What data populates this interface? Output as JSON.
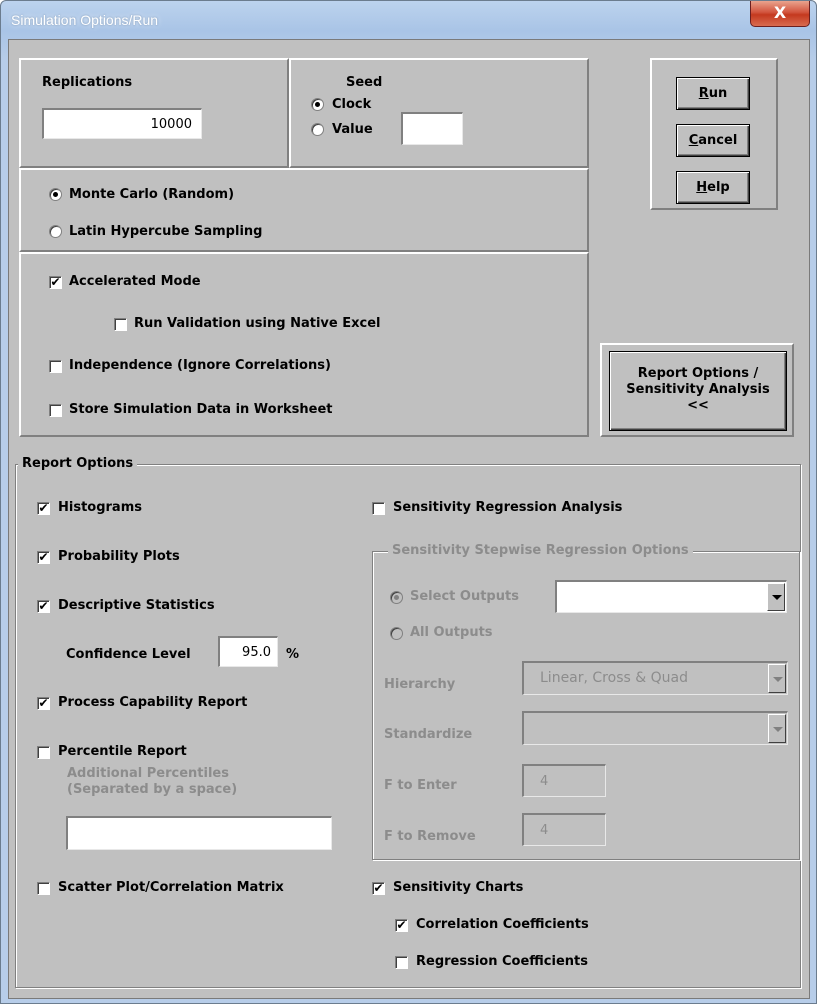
{
  "window": {
    "title": "Simulation Options/Run",
    "close_label": "X"
  },
  "replications": {
    "label": "Replications",
    "value": "10000"
  },
  "seed": {
    "label": "Seed",
    "clock_label": "Clock",
    "value_label": "Value",
    "value": ""
  },
  "sampling": {
    "monte_carlo_label": "Monte Carlo (Random)",
    "lhs_label": "Latin Hypercube Sampling"
  },
  "options": {
    "accelerated_label": "Accelerated Mode",
    "run_validation_label": "Run Validation using Native Excel",
    "independence_label": "Independence (Ignore Correlations)",
    "store_data_label": "Store Simulation Data in Worksheet"
  },
  "buttons": {
    "run_prefix": "R",
    "run_rest": "un",
    "cancel_prefix": "C",
    "cancel_rest": "ancel",
    "help_prefix": "H",
    "help_rest": "elp",
    "report_line1": "Report Options /",
    "report_line2": "Sensitivity Analysis",
    "report_line3": "<<"
  },
  "report": {
    "legend": "Report Options",
    "histograms_label": "Histograms",
    "probability_label": "Probability Plots",
    "descriptive_label": "Descriptive Statistics",
    "confidence_label": "Confidence Level",
    "confidence_value": "95.0",
    "percent_sign": "%",
    "process_label": "Process Capability Report",
    "percentile_label": "Percentile Report",
    "additional_line1": "Additional Percentiles",
    "additional_line2": "(Separated by a space)",
    "additional_value": "",
    "scatter_label": "Scatter Plot/Correlation Matrix"
  },
  "sensitivity": {
    "regression_label": "Sensitivity Regression Analysis",
    "stepwise_legend": "Sensitivity Stepwise Regression Options",
    "select_outputs_label": "Select Outputs",
    "all_outputs_label": "All Outputs",
    "hierarchy_label": "Hierarchy",
    "hierarchy_value": "Linear, Cross & Quad",
    "standardize_label": "Standardize",
    "standardize_value": "",
    "f_enter_label": "F to Enter",
    "f_enter_value": "4",
    "f_remove_label": "F to Remove",
    "f_remove_value": "4",
    "charts_label": "Sensitivity Charts",
    "correlation_label": "Correlation Coefficients",
    "regression_coeff_label": "Regression Coefficients"
  },
  "state": {
    "checked_mark": "✔",
    "accelerated": true,
    "run_validation": false,
    "independence": false,
    "store_data": false,
    "histograms": true,
    "probability": true,
    "descriptive": true,
    "process": true,
    "percentile": false,
    "scatter": false,
    "sensitivity_regression": false,
    "sensitivity_charts": true,
    "correlation": true,
    "regression_coeff": false
  }
}
